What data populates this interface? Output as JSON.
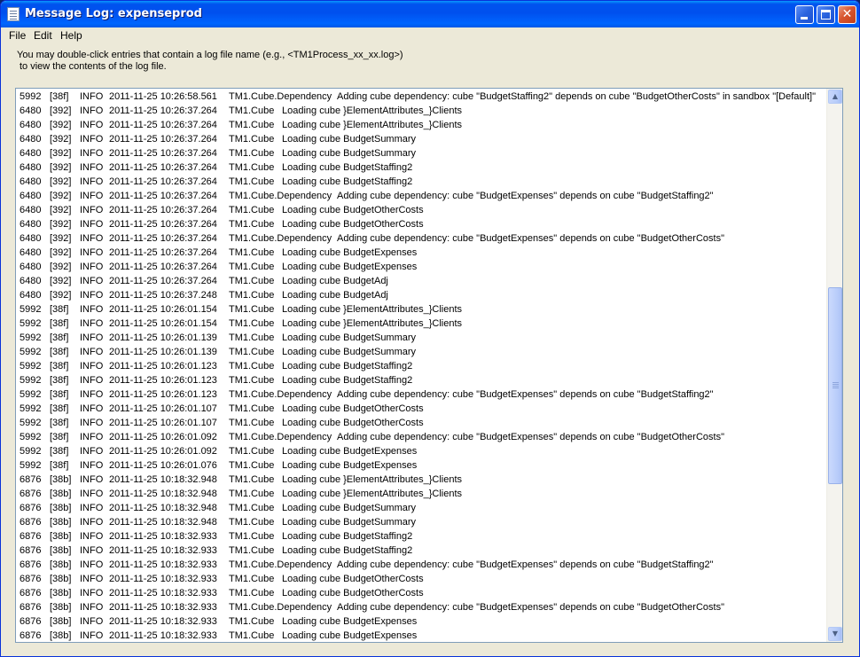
{
  "window": {
    "title": "Message Log: expenseprod"
  },
  "menu": {
    "file": "File",
    "edit": "Edit",
    "help": "Help"
  },
  "hint": {
    "line1": "You may double-click entries that contain a log file name (e.g., <TM1Process_xx_xx.log>)",
    "line2": "to view the contents of the log file."
  },
  "log_rows": [
    {
      "pid": "5992",
      "tid": "[38f]",
      "level": "INFO",
      "time": "2011-11-25 10:26:58.561",
      "logger": "TM1.Cube.Dependency",
      "message": "Adding cube dependency: cube \"BudgetStaffing2\" depends on cube \"BudgetOtherCosts\" in sandbox \"[Default]\""
    },
    {
      "pid": "6480",
      "tid": "[392]",
      "level": "INFO",
      "time": "2011-11-25 10:26:37.264",
      "logger": "TM1.Cube",
      "message": "Loading cube }ElementAttributes_}Clients"
    },
    {
      "pid": "6480",
      "tid": "[392]",
      "level": "INFO",
      "time": "2011-11-25 10:26:37.264",
      "logger": "TM1.Cube",
      "message": "Loading cube }ElementAttributes_}Clients"
    },
    {
      "pid": "6480",
      "tid": "[392]",
      "level": "INFO",
      "time": "2011-11-25 10:26:37.264",
      "logger": "TM1.Cube",
      "message": "Loading cube BudgetSummary"
    },
    {
      "pid": "6480",
      "tid": "[392]",
      "level": "INFO",
      "time": "2011-11-25 10:26:37.264",
      "logger": "TM1.Cube",
      "message": "Loading cube BudgetSummary"
    },
    {
      "pid": "6480",
      "tid": "[392]",
      "level": "INFO",
      "time": "2011-11-25 10:26:37.264",
      "logger": "TM1.Cube",
      "message": "Loading cube BudgetStaffing2"
    },
    {
      "pid": "6480",
      "tid": "[392]",
      "level": "INFO",
      "time": "2011-11-25 10:26:37.264",
      "logger": "TM1.Cube",
      "message": "Loading cube BudgetStaffing2"
    },
    {
      "pid": "6480",
      "tid": "[392]",
      "level": "INFO",
      "time": "2011-11-25 10:26:37.264",
      "logger": "TM1.Cube.Dependency",
      "message": "Adding cube dependency: cube \"BudgetExpenses\" depends on cube \"BudgetStaffing2\""
    },
    {
      "pid": "6480",
      "tid": "[392]",
      "level": "INFO",
      "time": "2011-11-25 10:26:37.264",
      "logger": "TM1.Cube",
      "message": "Loading cube BudgetOtherCosts"
    },
    {
      "pid": "6480",
      "tid": "[392]",
      "level": "INFO",
      "time": "2011-11-25 10:26:37.264",
      "logger": "TM1.Cube",
      "message": "Loading cube BudgetOtherCosts"
    },
    {
      "pid": "6480",
      "tid": "[392]",
      "level": "INFO",
      "time": "2011-11-25 10:26:37.264",
      "logger": "TM1.Cube.Dependency",
      "message": "Adding cube dependency: cube \"BudgetExpenses\" depends on cube \"BudgetOtherCosts\""
    },
    {
      "pid": "6480",
      "tid": "[392]",
      "level": "INFO",
      "time": "2011-11-25 10:26:37.264",
      "logger": "TM1.Cube",
      "message": "Loading cube BudgetExpenses"
    },
    {
      "pid": "6480",
      "tid": "[392]",
      "level": "INFO",
      "time": "2011-11-25 10:26:37.264",
      "logger": "TM1.Cube",
      "message": "Loading cube BudgetExpenses"
    },
    {
      "pid": "6480",
      "tid": "[392]",
      "level": "INFO",
      "time": "2011-11-25 10:26:37.264",
      "logger": "TM1.Cube",
      "message": "Loading cube BudgetAdj"
    },
    {
      "pid": "6480",
      "tid": "[392]",
      "level": "INFO",
      "time": "2011-11-25 10:26:37.248",
      "logger": "TM1.Cube",
      "message": "Loading cube BudgetAdj"
    },
    {
      "pid": "5992",
      "tid": "[38f]",
      "level": "INFO",
      "time": "2011-11-25 10:26:01.154",
      "logger": "TM1.Cube",
      "message": "Loading cube }ElementAttributes_}Clients"
    },
    {
      "pid": "5992",
      "tid": "[38f]",
      "level": "INFO",
      "time": "2011-11-25 10:26:01.154",
      "logger": "TM1.Cube",
      "message": "Loading cube }ElementAttributes_}Clients"
    },
    {
      "pid": "5992",
      "tid": "[38f]",
      "level": "INFO",
      "time": "2011-11-25 10:26:01.139",
      "logger": "TM1.Cube",
      "message": "Loading cube BudgetSummary"
    },
    {
      "pid": "5992",
      "tid": "[38f]",
      "level": "INFO",
      "time": "2011-11-25 10:26:01.139",
      "logger": "TM1.Cube",
      "message": "Loading cube BudgetSummary"
    },
    {
      "pid": "5992",
      "tid": "[38f]",
      "level": "INFO",
      "time": "2011-11-25 10:26:01.123",
      "logger": "TM1.Cube",
      "message": "Loading cube BudgetStaffing2"
    },
    {
      "pid": "5992",
      "tid": "[38f]",
      "level": "INFO",
      "time": "2011-11-25 10:26:01.123",
      "logger": "TM1.Cube",
      "message": "Loading cube BudgetStaffing2"
    },
    {
      "pid": "5992",
      "tid": "[38f]",
      "level": "INFO",
      "time": "2011-11-25 10:26:01.123",
      "logger": "TM1.Cube.Dependency",
      "message": "Adding cube dependency: cube \"BudgetExpenses\" depends on cube \"BudgetStaffing2\""
    },
    {
      "pid": "5992",
      "tid": "[38f]",
      "level": "INFO",
      "time": "2011-11-25 10:26:01.107",
      "logger": "TM1.Cube",
      "message": "Loading cube BudgetOtherCosts"
    },
    {
      "pid": "5992",
      "tid": "[38f]",
      "level": "INFO",
      "time": "2011-11-25 10:26:01.107",
      "logger": "TM1.Cube",
      "message": "Loading cube BudgetOtherCosts"
    },
    {
      "pid": "5992",
      "tid": "[38f]",
      "level": "INFO",
      "time": "2011-11-25 10:26:01.092",
      "logger": "TM1.Cube.Dependency",
      "message": "Adding cube dependency: cube \"BudgetExpenses\" depends on cube \"BudgetOtherCosts\""
    },
    {
      "pid": "5992",
      "tid": "[38f]",
      "level": "INFO",
      "time": "2011-11-25 10:26:01.092",
      "logger": "TM1.Cube",
      "message": "Loading cube BudgetExpenses"
    },
    {
      "pid": "5992",
      "tid": "[38f]",
      "level": "INFO",
      "time": "2011-11-25 10:26:01.076",
      "logger": "TM1.Cube",
      "message": "Loading cube BudgetExpenses"
    },
    {
      "pid": "6876",
      "tid": "[38b]",
      "level": "INFO",
      "time": "2011-11-25 10:18:32.948",
      "logger": "TM1.Cube",
      "message": "Loading cube }ElementAttributes_}Clients"
    },
    {
      "pid": "6876",
      "tid": "[38b]",
      "level": "INFO",
      "time": "2011-11-25 10:18:32.948",
      "logger": "TM1.Cube",
      "message": "Loading cube }ElementAttributes_}Clients"
    },
    {
      "pid": "6876",
      "tid": "[38b]",
      "level": "INFO",
      "time": "2011-11-25 10:18:32.948",
      "logger": "TM1.Cube",
      "message": "Loading cube BudgetSummary"
    },
    {
      "pid": "6876",
      "tid": "[38b]",
      "level": "INFO",
      "time": "2011-11-25 10:18:32.948",
      "logger": "TM1.Cube",
      "message": "Loading cube BudgetSummary"
    },
    {
      "pid": "6876",
      "tid": "[38b]",
      "level": "INFO",
      "time": "2011-11-25 10:18:32.933",
      "logger": "TM1.Cube",
      "message": "Loading cube BudgetStaffing2"
    },
    {
      "pid": "6876",
      "tid": "[38b]",
      "level": "INFO",
      "time": "2011-11-25 10:18:32.933",
      "logger": "TM1.Cube",
      "message": "Loading cube BudgetStaffing2"
    },
    {
      "pid": "6876",
      "tid": "[38b]",
      "level": "INFO",
      "time": "2011-11-25 10:18:32.933",
      "logger": "TM1.Cube.Dependency",
      "message": "Adding cube dependency: cube \"BudgetExpenses\" depends on cube \"BudgetStaffing2\""
    },
    {
      "pid": "6876",
      "tid": "[38b]",
      "level": "INFO",
      "time": "2011-11-25 10:18:32.933",
      "logger": "TM1.Cube",
      "message": "Loading cube BudgetOtherCosts"
    },
    {
      "pid": "6876",
      "tid": "[38b]",
      "level": "INFO",
      "time": "2011-11-25 10:18:32.933",
      "logger": "TM1.Cube",
      "message": "Loading cube BudgetOtherCosts"
    },
    {
      "pid": "6876",
      "tid": "[38b]",
      "level": "INFO",
      "time": "2011-11-25 10:18:32.933",
      "logger": "TM1.Cube.Dependency",
      "message": "Adding cube dependency: cube \"BudgetExpenses\" depends on cube \"BudgetOtherCosts\""
    },
    {
      "pid": "6876",
      "tid": "[38b]",
      "level": "INFO",
      "time": "2011-11-25 10:18:32.933",
      "logger": "TM1.Cube",
      "message": "Loading cube BudgetExpenses"
    },
    {
      "pid": "6876",
      "tid": "[38b]",
      "level": "INFO",
      "time": "2011-11-25 10:18:32.933",
      "logger": "TM1.Cube",
      "message": "Loading cube BudgetExpenses"
    }
  ],
  "icons": {
    "app": "document-log-icon",
    "minimize": "minimize-icon",
    "maximize": "maximize-icon",
    "close": "close-icon",
    "scroll_up": "arrow-up-icon",
    "scroll_down": "arrow-down-icon"
  },
  "colors": {
    "titlebar": "#0053ee",
    "window_bg": "#ece9d8",
    "list_bg": "#ffffff",
    "close_button": "#d8562f"
  }
}
